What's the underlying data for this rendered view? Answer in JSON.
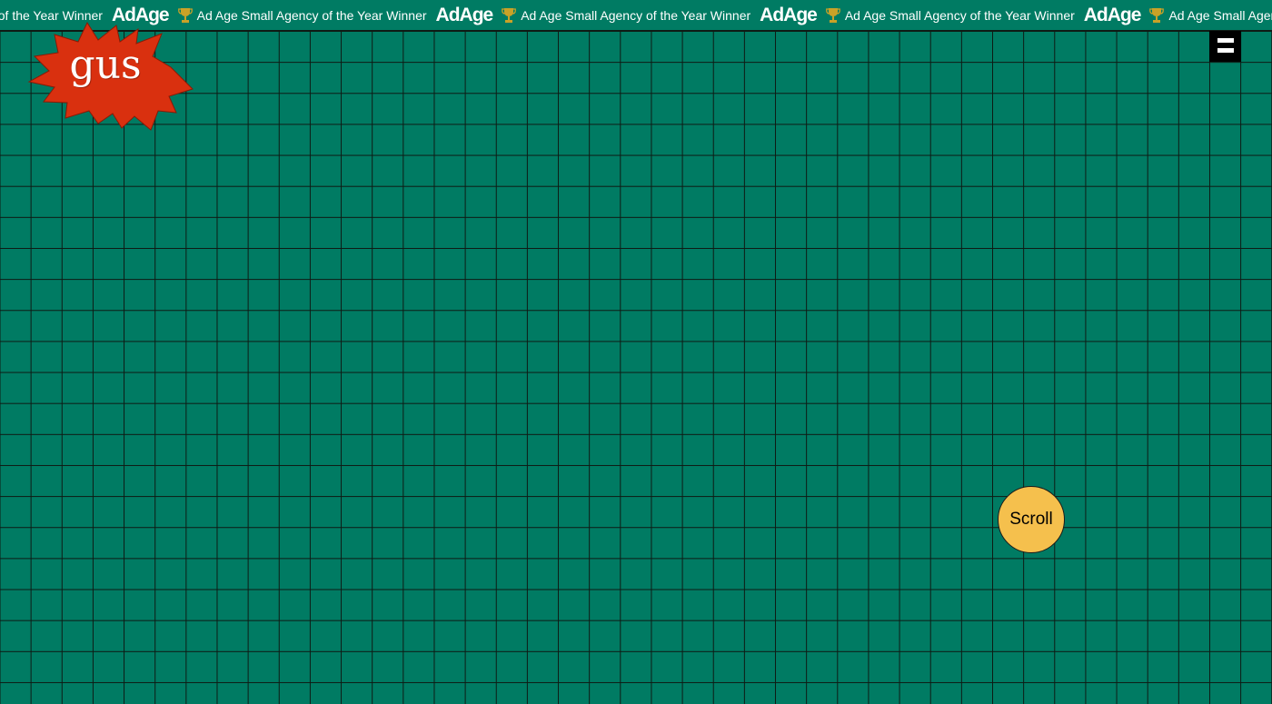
{
  "ticker": {
    "lead_text": "Ad Age Small Agency of the Year Winner",
    "items": [
      {
        "logo": "AdAge",
        "icon": "trophy-icon",
        "text": "Ad Age Small Agency of the Year Winner"
      },
      {
        "logo": "AdAge",
        "icon": "trophy-icon",
        "text": "Ad Age Small Agency of the Year Winner"
      },
      {
        "logo": "AdAge",
        "icon": "trophy-icon",
        "text": "Ad Age Small Agency of the Year Winner"
      },
      {
        "logo": "AdAge",
        "icon": "trophy-icon",
        "text": "Ad Age Small Agency of the Year Winner"
      }
    ]
  },
  "logo": {
    "text": "gus",
    "color": "#d9300f"
  },
  "menu": {
    "icon": "hamburger-menu-icon"
  },
  "scroll_button": {
    "label": "Scroll",
    "color": "#f5c04d"
  },
  "colors": {
    "background": "#007b63",
    "grid_line": "#0e1a14"
  }
}
